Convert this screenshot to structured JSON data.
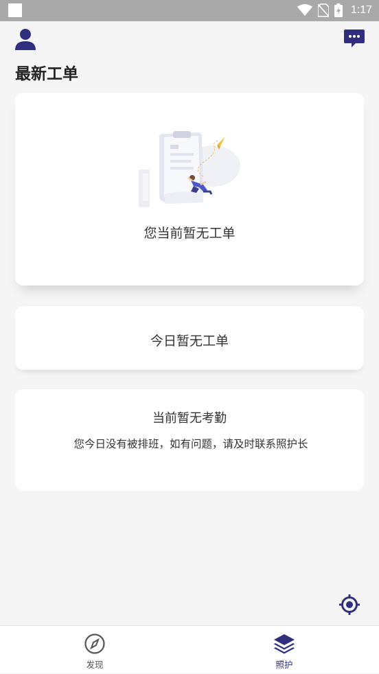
{
  "status_bar": {
    "time": "1:17"
  },
  "page": {
    "title": "最新工单"
  },
  "work_orders": {
    "empty_text": "您当前暂无工单",
    "illustration_icon": "empty-clipboard-illustration"
  },
  "today": {
    "text": "今日暂无工单"
  },
  "attendance": {
    "title": "当前暂无考勤",
    "description": "您今日没有被排班，如有问题，请及时联系照护长"
  },
  "bottom_nav": {
    "items": [
      {
        "label": "发现",
        "icon": "compass-icon",
        "active": false
      },
      {
        "label": "照护",
        "icon": "layers-icon",
        "active": true
      }
    ]
  },
  "colors": {
    "accent": "#2f2f7e",
    "background": "#f5f5f5",
    "status_bar": "#a9a9a9"
  }
}
